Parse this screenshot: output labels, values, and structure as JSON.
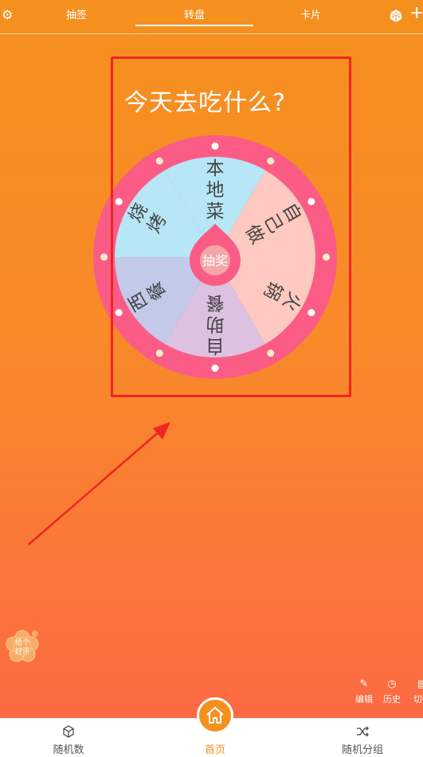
{
  "header": {
    "tabs": [
      {
        "label": "抽签"
      },
      {
        "label": "转盘"
      },
      {
        "label": "卡片"
      }
    ],
    "active_tab": 1
  },
  "wheel": {
    "title": "今天去吃什么?",
    "center_label": "抽奖",
    "segments": [
      {
        "label": "本地菜",
        "color": "#b7e6f7"
      },
      {
        "label": "自己做",
        "color": "#fdc9c0"
      },
      {
        "label": "火锅",
        "color": "#fdc9c0"
      },
      {
        "label": "自助餐",
        "color": "#dcc1e0"
      },
      {
        "label": "西餐",
        "color": "#c3c9e8"
      },
      {
        "label": "烧烤",
        "color": "#b7e6f7"
      }
    ],
    "ring_color": "#fb5c86",
    "pointer_color": "#fb5c86"
  },
  "rate_badge": {
    "label": "给个好评"
  },
  "tools": [
    {
      "label": "编辑",
      "icon": "pencil-icon"
    },
    {
      "label": "历史",
      "icon": "clock-icon"
    },
    {
      "label": "切换",
      "icon": "switch-icon"
    }
  ],
  "bottom_nav": [
    {
      "label": "随机数",
      "icon": "cube-icon"
    },
    {
      "label": "首页",
      "icon": "home-icon"
    },
    {
      "label": "随机分组",
      "icon": "shuffle-icon"
    }
  ],
  "colors": {
    "accent": "#f5901e",
    "annotation": "#ee2525"
  }
}
